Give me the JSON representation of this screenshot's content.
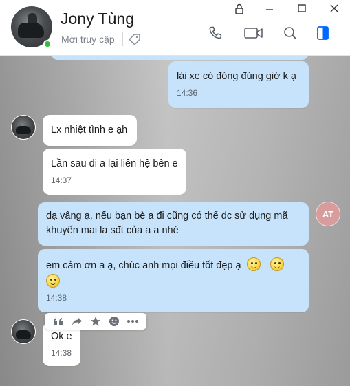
{
  "contact": {
    "name": "Jony Tùng",
    "status": "Mới truy cập",
    "online": true
  },
  "messages": [
    {
      "direction": "out",
      "text": "lái xe có đóng đúng giờ k ạ",
      "time": "14:36"
    },
    {
      "direction": "in",
      "text": "Lx nhiệt tình e ạh",
      "time": ""
    },
    {
      "direction": "in",
      "text": "Lần sau đi a lại liên hệ bên e",
      "time": "14:37"
    },
    {
      "direction": "out",
      "text_lines": [
        "dạ vâng ạ, nếu bạn bè a đi cũng có thể dc sử dụng mã",
        "khuyến mai la sđt của a a nhé"
      ],
      "time": ""
    },
    {
      "direction": "out",
      "text": "em cảm ơn a ạ, chúc anh mọi điều tốt đẹp ạ",
      "time": "14:38",
      "emojis": 3
    },
    {
      "direction": "in",
      "text": "Ok e",
      "time": "14:38"
    }
  ],
  "self_avatar_initials": "AT",
  "message_actions": [
    "quote-icon",
    "forward-icon",
    "star-icon",
    "emoji-reaction-icon",
    "more-icon"
  ],
  "header_icons": [
    "phone-icon",
    "video-call-icon",
    "search-icon",
    "sidebar-toggle-icon"
  ],
  "window_controls": [
    "lock-icon",
    "minimize-icon",
    "maximize-icon",
    "close-icon"
  ],
  "colors": {
    "outgoing_bubble": "#c6e3fb",
    "incoming_bubble": "#ffffff",
    "accent_blue": "#0068ff",
    "online_green": "#2fbf3b",
    "self_avatar_bg": "#d99c9c"
  }
}
